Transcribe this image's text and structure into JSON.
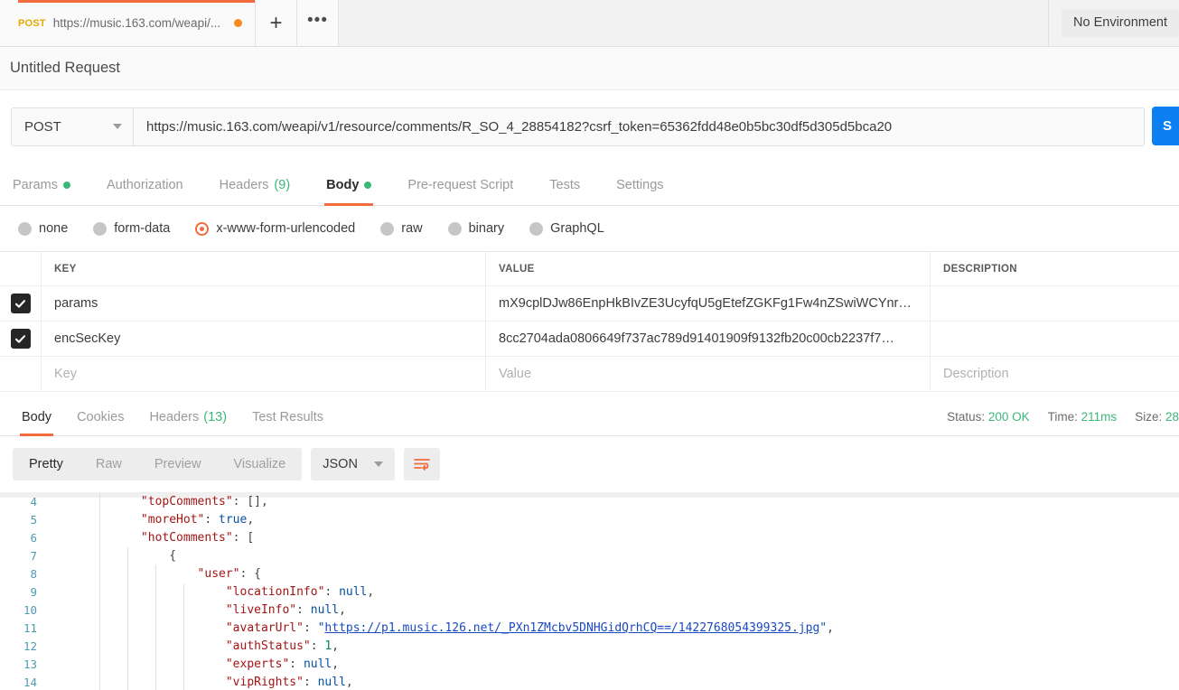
{
  "tabstrip": {
    "request_tab": {
      "method": "POST",
      "url": "https://music.163.com/weapi/...",
      "unsaved_indicator": "unsaved-dot"
    },
    "new_tab_label": "+",
    "more_label": "•••",
    "environment_selector": "No Environment"
  },
  "request": {
    "title": "Untitled Request",
    "method": "POST",
    "url": "https://music.163.com/weapi/v1/resource/comments/R_SO_4_28854182?csrf_token=65362fdd48e0b5bc30df5d305d5bca20",
    "send_label": "S"
  },
  "request_tabs": [
    {
      "label": "Params",
      "dot": true,
      "count": "",
      "active": false
    },
    {
      "label": "Authorization",
      "dot": false,
      "count": "",
      "active": false
    },
    {
      "label": "Headers",
      "dot": false,
      "count": "(9)",
      "active": false
    },
    {
      "label": "Body",
      "dot": true,
      "count": "",
      "active": true
    },
    {
      "label": "Pre-request Script",
      "dot": false,
      "count": "",
      "active": false
    },
    {
      "label": "Tests",
      "dot": false,
      "count": "",
      "active": false
    },
    {
      "label": "Settings",
      "dot": false,
      "count": "",
      "active": false
    }
  ],
  "body_types": [
    {
      "label": "none",
      "selected": false
    },
    {
      "label": "form-data",
      "selected": false
    },
    {
      "label": "x-www-form-urlencoded",
      "selected": true
    },
    {
      "label": "raw",
      "selected": false
    },
    {
      "label": "binary",
      "selected": false
    },
    {
      "label": "GraphQL",
      "selected": false
    }
  ],
  "kv_table": {
    "headers": {
      "key": "KEY",
      "value": "VALUE",
      "description": "DESCRIPTION"
    },
    "rows": [
      {
        "checked": true,
        "key": "params",
        "value": "mX9cplDJw86EnpHkBIvZE3UcyfqU5gEtefZGKFg1Fw4nZSwiWCYnr…",
        "description": ""
      },
      {
        "checked": true,
        "key": "encSecKey",
        "value": "8cc2704ada0806649f737ac789d91401909f9132fb20c00cb2237f7…",
        "description": ""
      }
    ],
    "placeholder_row": {
      "key": "Key",
      "value": "Value",
      "description": "Description"
    }
  },
  "response": {
    "tabs": [
      {
        "label": "Body",
        "count": "",
        "active": true
      },
      {
        "label": "Cookies",
        "count": "",
        "active": false
      },
      {
        "label": "Headers",
        "count": "(13)",
        "active": false
      },
      {
        "label": "Test Results",
        "count": "",
        "active": false
      }
    ],
    "meta": {
      "status_label": "Status:",
      "status_value": "200 OK",
      "time_label": "Time:",
      "time_value": "211ms",
      "size_label": "Size:",
      "size_value": "28"
    },
    "format_tabs": [
      {
        "label": "Pretty",
        "active": true
      },
      {
        "label": "Raw",
        "active": false
      },
      {
        "label": "Preview",
        "active": false
      },
      {
        "label": "Visualize",
        "active": false
      }
    ],
    "language": "JSON",
    "wrap_icon": "wrap-lines-icon"
  },
  "code": {
    "lines": [
      {
        "num": "4",
        "indent": 2,
        "guides": 1,
        "segments": [
          {
            "t": "\"topComments\"",
            "c": "k"
          },
          {
            "t": ": ",
            "c": "p"
          },
          {
            "t": "[]",
            "c": "p"
          },
          {
            "t": ",",
            "c": "p"
          }
        ]
      },
      {
        "num": "5",
        "indent": 2,
        "guides": 1,
        "segments": [
          {
            "t": "\"moreHot\"",
            "c": "k"
          },
          {
            "t": ": ",
            "c": "p"
          },
          {
            "t": "true",
            "c": "b"
          },
          {
            "t": ",",
            "c": "p"
          }
        ]
      },
      {
        "num": "6",
        "indent": 2,
        "guides": 1,
        "segments": [
          {
            "t": "\"hotComments\"",
            "c": "k"
          },
          {
            "t": ": ",
            "c": "p"
          },
          {
            "t": "[",
            "c": "p"
          }
        ]
      },
      {
        "num": "7",
        "indent": 4,
        "guides": 2,
        "segments": [
          {
            "t": "{",
            "c": "p"
          }
        ]
      },
      {
        "num": "8",
        "indent": 6,
        "guides": 3,
        "segments": [
          {
            "t": "\"user\"",
            "c": "k"
          },
          {
            "t": ": ",
            "c": "p"
          },
          {
            "t": "{",
            "c": "p"
          }
        ]
      },
      {
        "num": "9",
        "indent": 8,
        "guides": 4,
        "segments": [
          {
            "t": "\"locationInfo\"",
            "c": "k"
          },
          {
            "t": ": ",
            "c": "p"
          },
          {
            "t": "null",
            "c": "b"
          },
          {
            "t": ",",
            "c": "p"
          }
        ]
      },
      {
        "num": "10",
        "indent": 8,
        "guides": 4,
        "segments": [
          {
            "t": "\"liveInfo\"",
            "c": "k"
          },
          {
            "t": ": ",
            "c": "p"
          },
          {
            "t": "null",
            "c": "b"
          },
          {
            "t": ",",
            "c": "p"
          }
        ]
      },
      {
        "num": "11",
        "indent": 8,
        "guides": 4,
        "segments": [
          {
            "t": "\"avatarUrl\"",
            "c": "k"
          },
          {
            "t": ": ",
            "c": "p"
          },
          {
            "t": "\"",
            "c": "s"
          },
          {
            "t": "https://p1.music.126.net/_PXn1ZMcbv5DNHGidQrhCQ==/1422768054399325.jpg",
            "c": "lnk"
          },
          {
            "t": "\"",
            "c": "s"
          },
          {
            "t": ",",
            "c": "p"
          }
        ]
      },
      {
        "num": "12",
        "indent": 8,
        "guides": 4,
        "segments": [
          {
            "t": "\"authStatus\"",
            "c": "k"
          },
          {
            "t": ": ",
            "c": "p"
          },
          {
            "t": "1",
            "c": "n"
          },
          {
            "t": ",",
            "c": "p"
          }
        ]
      },
      {
        "num": "13",
        "indent": 8,
        "guides": 4,
        "segments": [
          {
            "t": "\"experts\"",
            "c": "k"
          },
          {
            "t": ": ",
            "c": "p"
          },
          {
            "t": "null",
            "c": "b"
          },
          {
            "t": ",",
            "c": "p"
          }
        ]
      },
      {
        "num": "14",
        "indent": 8,
        "guides": 4,
        "segments": [
          {
            "t": "\"vipRights\"",
            "c": "k"
          },
          {
            "t": ": ",
            "c": "p"
          },
          {
            "t": "null",
            "c": "b"
          },
          {
            "t": ",",
            "c": "p"
          }
        ]
      }
    ]
  }
}
